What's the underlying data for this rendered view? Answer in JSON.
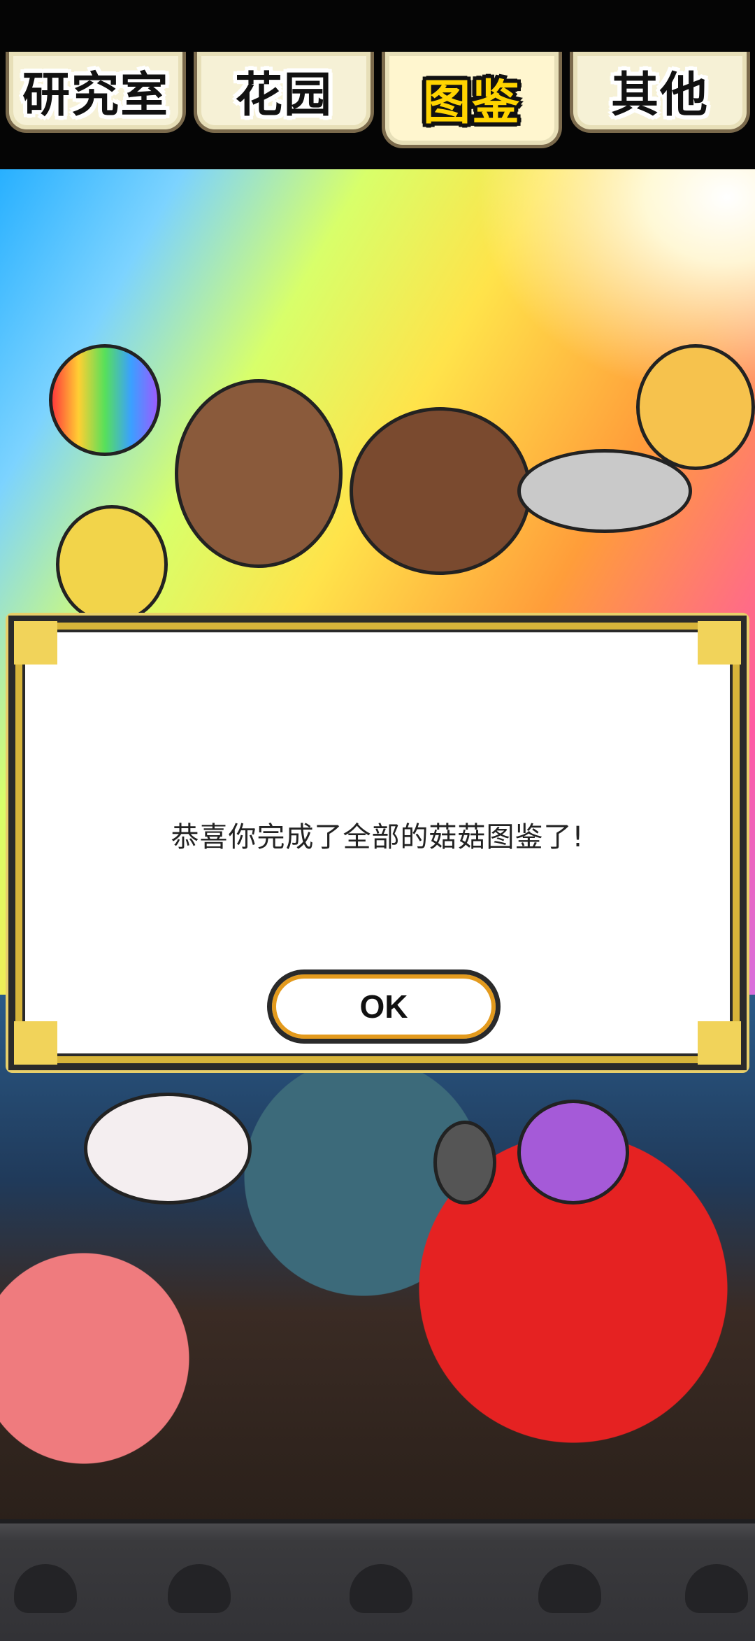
{
  "tabs": [
    {
      "label": "研究室",
      "active": false
    },
    {
      "label": "花园",
      "active": false
    },
    {
      "label": "图鉴",
      "active": true
    },
    {
      "label": "其他",
      "active": false
    }
  ],
  "dialog": {
    "message": "恭喜你完成了全部的菇菇图鉴了!",
    "ok_label": "OK"
  },
  "colors": {
    "active_tab_text": "#ffd400",
    "ok_button_ring": "#e39a1d",
    "dialog_frame_gold": "#d7b43a"
  }
}
